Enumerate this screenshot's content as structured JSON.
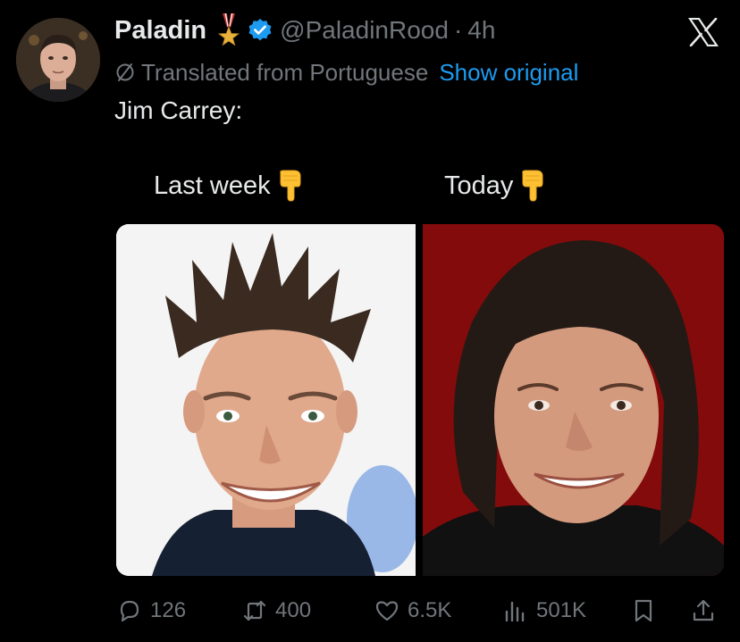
{
  "author": {
    "name": "Paladin",
    "handle": "@PaladinRood",
    "separator": "·",
    "time": "4h",
    "badges": [
      "medal-icon",
      "verified-icon"
    ]
  },
  "translation": {
    "note": "Translated from Portuguese",
    "action": "Show original"
  },
  "post": {
    "text": "Jim Carrey:"
  },
  "media": {
    "left_label": "Last week",
    "right_label": "Today",
    "label_icon": "backhand-pointing-down-icon",
    "left_bg": "#eeeeee",
    "right_bg": "#8e0c0c"
  },
  "actions": {
    "replies": "126",
    "reposts": "400",
    "likes": "6.5K",
    "views": "501K"
  },
  "colors": {
    "background": "#000000",
    "text": "#e7e9ea",
    "muted": "#71767b",
    "accent": "#1d9bf0"
  }
}
